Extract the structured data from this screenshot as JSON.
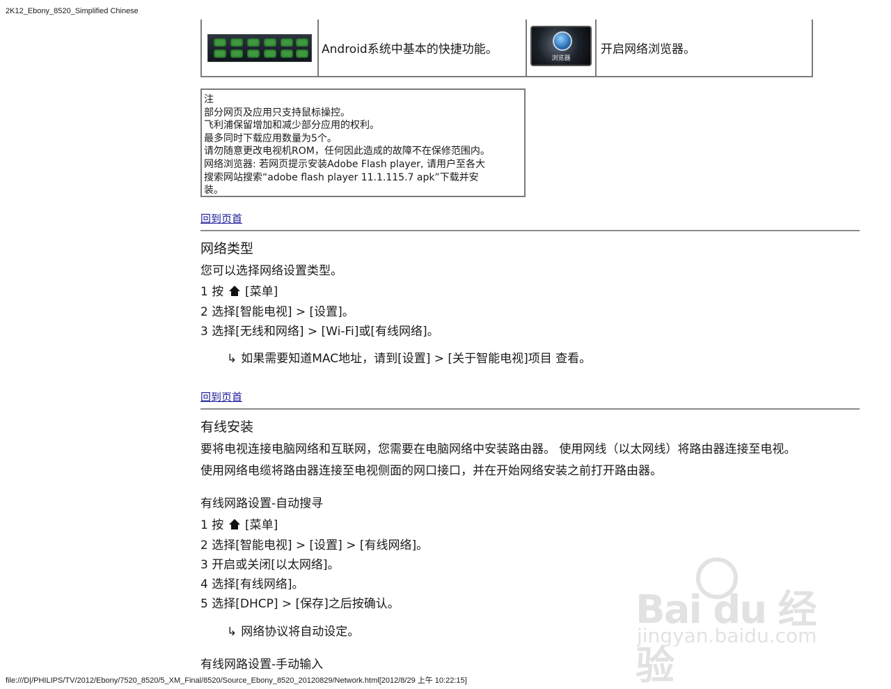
{
  "header": {
    "doc_title": "2K12_Ebony_8520_Simplified Chinese"
  },
  "footer": {
    "path": "file:///D|/PHILIPS/TV/2012/Ebony/7520_8520/5_XM_Final/8520/Source_Ebony_8520_20120829/Network.html[2012/8/29 上午 10:22:15]"
  },
  "app_table": {
    "row": {
      "text1": "Android系统中基本的快捷功能。",
      "img2_caption": "浏览器",
      "text2": "开启网络浏览器。"
    }
  },
  "note": {
    "title": "注",
    "lines": [
      "部分网页及应用只支持鼠标操控。",
      "飞利浦保留增加和减少部分应用的权利。",
      "最多同时下载应用数量为5个。",
      "请勿随意更改电视机ROM，任何因此造成的故障不在保修范围内。",
      "网络浏览器: 若网页提示安装Adobe Flash player, 请用户至各大",
      "搜索网站搜索“adobe flash player 11.1.115.7 apk”下载并安",
      "装。"
    ]
  },
  "back_link_label": "回到页首",
  "network_type": {
    "title": "网络类型",
    "intro": "您可以选择网络设置类型。",
    "step1_prefix": "1 按",
    "step1_suffix": "[菜单]",
    "step2": "2 选择[智能电视] > [设置]。",
    "step3": "3 选择[无线和网络] > [Wi-Fi]或[有线网络]。",
    "result": "如果需要知道MAC地址，请到[设置] > [关于智能电视]项目 查看。"
  },
  "wired_install": {
    "title": "有线安装",
    "para1": "要将电视连接电脑网络和互联网，您需要在电脑网络中安装路由器。 使用网线（以太网线）将路由器连接至电视。",
    "para2": "使用网络电缆将路由器连接至电视侧面的网口接口，并在开始网络安装之前打开路由器。",
    "auto_title": "有线网路设置-自动搜寻",
    "step1_prefix": "1 按",
    "step1_suffix": "[菜单]",
    "step2": "2 选择[智能电视] > [设置] > [有线网络]。",
    "step3": "3 开启或关闭[以太网络]。",
    "step4": "4 选择[有线网络]。",
    "step5": "5 选择[DHCP] > [保存]之后按确认。",
    "result": "网络协议将自动设定。",
    "manual_title": "有线网路设置-手动输入"
  },
  "watermark": {
    "main": "Bai du 经验",
    "sub": "jingyan.baidu.com"
  },
  "icons": {
    "arrow": "↳",
    "home": "home-icon"
  }
}
